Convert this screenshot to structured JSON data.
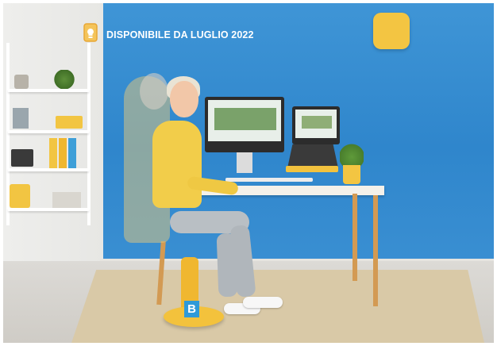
{
  "banner": {
    "headline": "DISPONIBILE DA LUGLIO 2022",
    "icon": "lamp-icon"
  },
  "callout": {
    "marker_label": "B"
  },
  "colors": {
    "wall_blue": "#3b8fd0",
    "accent_yellow": "#f3c542",
    "marker_blue": "#2f9ad8",
    "headline_text": "#ffffff"
  }
}
